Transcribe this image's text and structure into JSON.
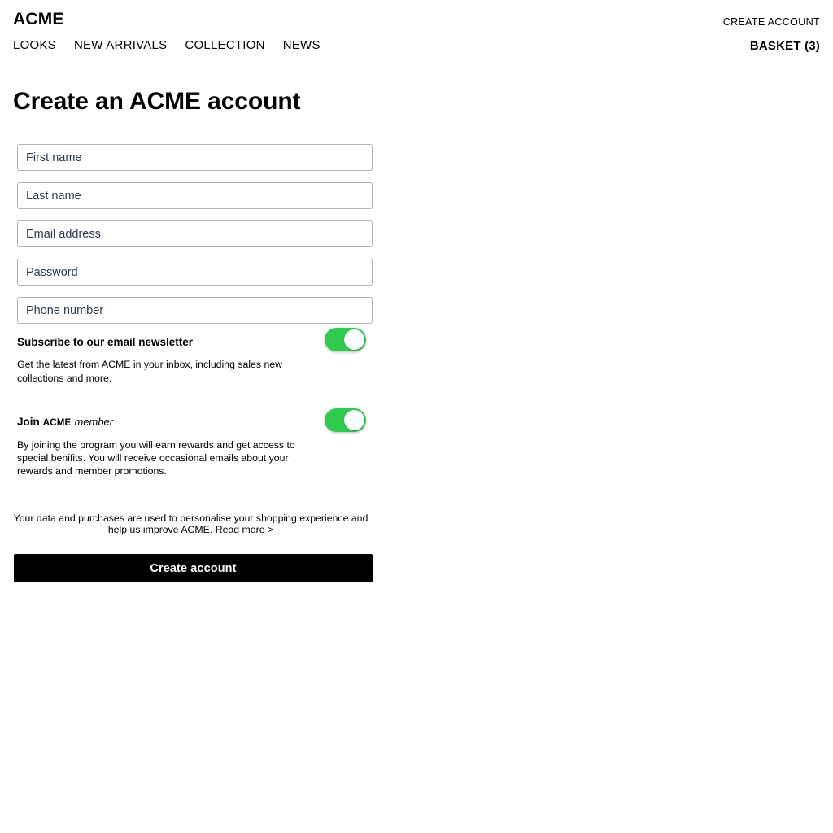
{
  "header": {
    "logo": "ACME",
    "nav_items": [
      {
        "label": "LOOKS"
      },
      {
        "label": "NEW ARRIVALS"
      },
      {
        "label": "COLLECTION"
      },
      {
        "label": "NEWS"
      }
    ],
    "create_account_link": "CREATE ACCOUNT",
    "basket_link": "BASKET (3)"
  },
  "main": {
    "title": "Create an ACME account",
    "fields": [
      {
        "name": "first-name",
        "placeholder": "First name",
        "value": "",
        "type": "text"
      },
      {
        "name": "last-name",
        "placeholder": "Last name",
        "value": "",
        "type": "text"
      },
      {
        "name": "email-address",
        "placeholder": "Email address",
        "value": "",
        "type": "email"
      },
      {
        "name": "password",
        "placeholder": "Password",
        "value": "",
        "type": "password"
      },
      {
        "name": "phone-number",
        "placeholder": "Phone number",
        "value": "",
        "type": "tel"
      }
    ],
    "newsletter": {
      "title": "Subscribe to our email newsletter",
      "description": "Get the latest from ACME in your inbox, including sales new collections and more.",
      "toggle_state": "on"
    },
    "membership": {
      "title_prefix": "Join",
      "title_brand": "ACME",
      "title_suffix": "member",
      "description": "By joining the program you will earn rewards and get access to special benifits. You will receive occasional emails about your rewards and member promotions.",
      "toggle_state": "on"
    },
    "privacy_note": "Your data and purchases are used to personalise your shopping experience and help us improve ACME.",
    "privacy_link": "Read more >",
    "submit_label": "Create account"
  },
  "colors": {
    "accent_green": "#2ecb4f",
    "button_black": "#000000",
    "field_border": "#aab2ba",
    "placeholder_text": "#2c3e50",
    "background": "#ffffff"
  }
}
